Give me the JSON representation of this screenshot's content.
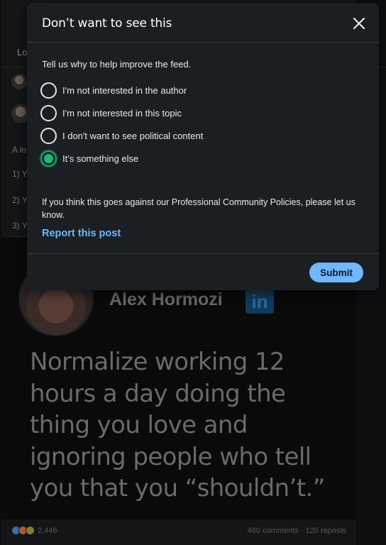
{
  "colors": {
    "modal_bg": "#1b1f23",
    "accent_link": "#71b7fb",
    "radio_selected": "#1eb87a",
    "submit_bg": "#71b7fb"
  },
  "background_feed": {
    "top_tab_label": "Lo",
    "side_heading": "A lo",
    "side_items": [
      "1) Y",
      "2) Y",
      "3) Y"
    ],
    "post": {
      "author_name": "Alex Hormozi",
      "linkedin_logo_text": "in",
      "quote": "Normalize working 12 hours a day doing the thing you love and ignoring people who tell you that you “shouldn’t.”",
      "reaction_count": "2,446",
      "engagement": "460 comments · 120 reposts"
    }
  },
  "modal": {
    "title": "Don’t want to see this",
    "close_icon": "close-icon",
    "prompt": "Tell us why to help improve the feed.",
    "options": [
      {
        "label": "I'm not interested in the author",
        "selected": false
      },
      {
        "label": "I'm not interested in this topic",
        "selected": false
      },
      {
        "label": "I don't want to see political content",
        "selected": false
      },
      {
        "label": "It's something else",
        "selected": true
      }
    ],
    "policy_text": "If you think this goes against our Professional Community Policies, please let us know.",
    "report_link": "Report this post",
    "submit_label": "Submit"
  }
}
